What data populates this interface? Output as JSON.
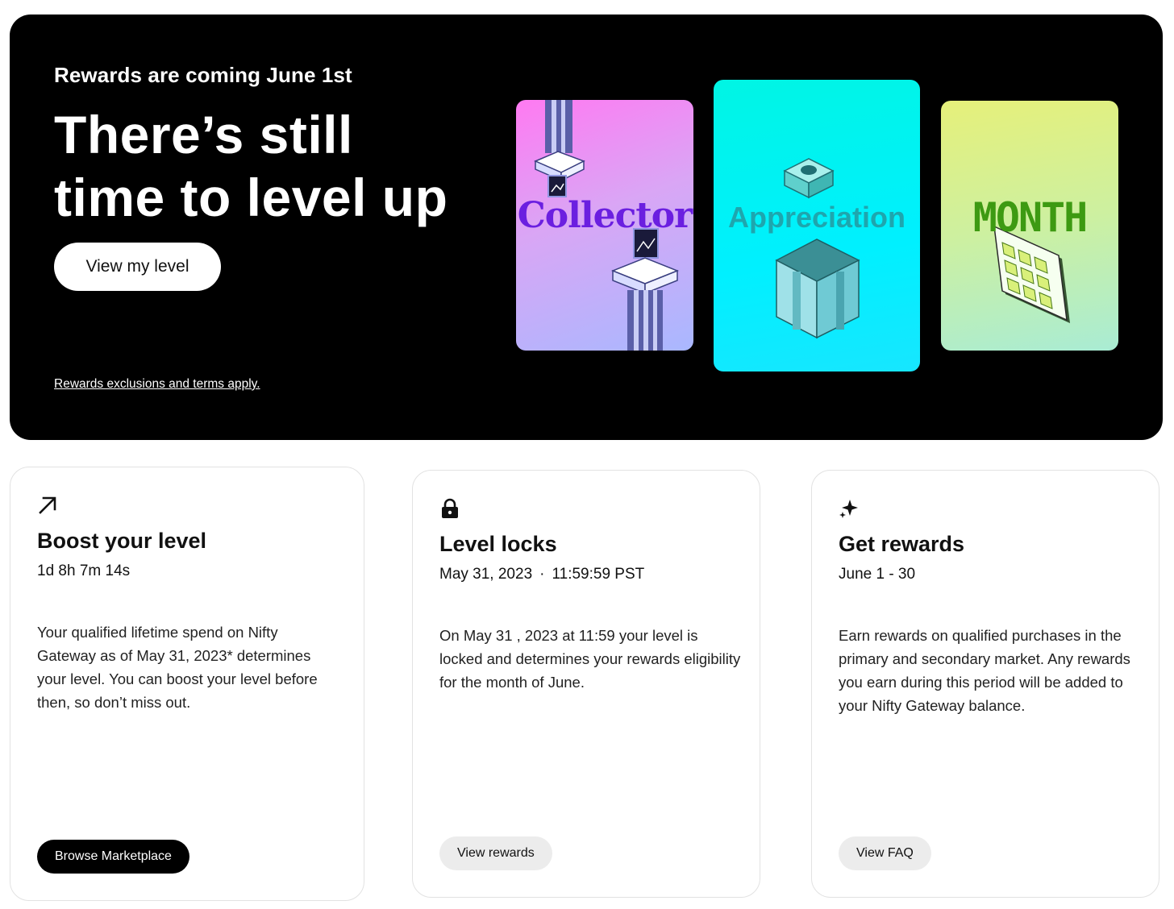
{
  "hero": {
    "eyebrow": "Rewards are coming June 1st",
    "title_line1": "There’s still",
    "title_line2": "time to level up",
    "button_label": "View my level",
    "terms_link": "Rewards exclusions and terms apply.",
    "art": {
      "collector": "Collector",
      "appreciation": "Appreciation",
      "month": "MONTH"
    }
  },
  "cards": [
    {
      "icon": "arrow-up-right-icon",
      "title": "Boost your level",
      "subtitle": "1d 8h 7m 14s",
      "body": "Your qualified lifetime spend on Nifty Gateway as of May 31, 2023* determines your level. You can boost your level before then, so don’t miss out.",
      "button": "Browse Marketplace"
    },
    {
      "icon": "lock-icon",
      "title": "Level locks",
      "subtitle_date": "May 31, 2023",
      "subtitle_sep": "·",
      "subtitle_time": "11:59:59 PST",
      "body": "On May 31 , 2023 at 11:59 your level is locked and determines your rewards eligibility for the month of June.",
      "button": "View rewards"
    },
    {
      "icon": "sparkle-icon",
      "title": "Get rewards",
      "subtitle": "June 1 - 30",
      "body": "Earn rewards on qualified purchases in the primary and secondary market. Any rewards you earn during this period will be added to your Nifty Gateway balance.",
      "button": "View FAQ"
    }
  ],
  "colors": {
    "hero_bg": "#000000",
    "collector_text": "#6b1fe0",
    "appreciation_text": "#1ea6ae",
    "month_text": "#3d9a12"
  }
}
